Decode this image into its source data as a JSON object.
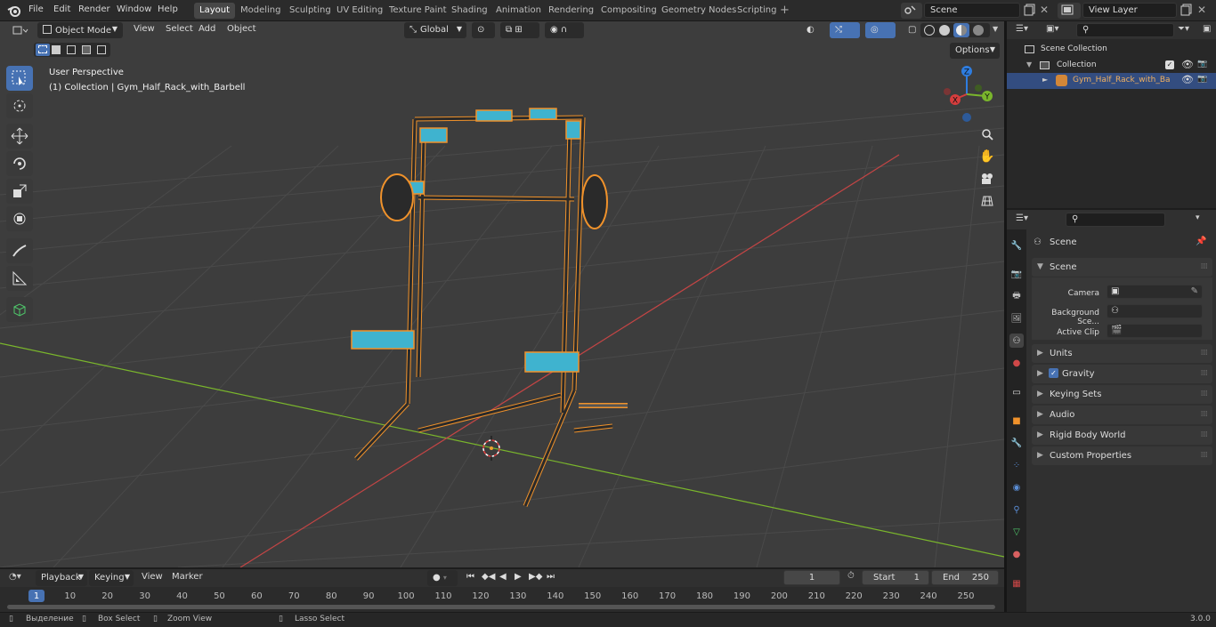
{
  "topbar": {
    "menus": [
      "File",
      "Edit",
      "Render",
      "Window",
      "Help"
    ],
    "workspaces": [
      "Layout",
      "Modeling",
      "Sculpting",
      "UV Editing",
      "Texture Paint",
      "Shading",
      "Animation",
      "Rendering",
      "Compositing",
      "Geometry Nodes",
      "Scripting"
    ],
    "active_workspace": "Layout",
    "add_tab": "+",
    "scene_value": "Scene",
    "view_layer_value": "View Layer"
  },
  "viewport": {
    "mode": "Object Mode",
    "menus": [
      "View",
      "Select",
      "Add",
      "Object"
    ],
    "orientation": "Global",
    "options_label": "Options",
    "overlay_title": "User Perspective",
    "overlay_subtitle": "(1) Collection | Gym_Half_Rack_with_Barbell",
    "gizmo": {
      "x": "X",
      "y": "Y",
      "z": "Z"
    }
  },
  "outliner": {
    "scene_collection": "Scene Collection",
    "collection": "Collection",
    "object": "Gym_Half_Rack_with_Ba"
  },
  "properties": {
    "header": "Scene",
    "section": "Scene",
    "camera_label": "Camera",
    "background_label": "Background Sce...",
    "clip_label": "Active Clip",
    "panels": [
      "Units",
      "Gravity",
      "Keying Sets",
      "Audio",
      "Rigid Body World",
      "Custom Properties"
    ],
    "gravity_checked": true
  },
  "timeline": {
    "menus": [
      "Playback",
      "Keying",
      "View",
      "Marker"
    ],
    "current_frame": "1",
    "start_label": "Start",
    "start_value": "1",
    "end_label": "End",
    "end_value": "250",
    "ticks": [
      "1",
      "10",
      "20",
      "30",
      "40",
      "50",
      "60",
      "70",
      "80",
      "90",
      "100",
      "110",
      "120",
      "130",
      "140",
      "150",
      "160",
      "170",
      "180",
      "190",
      "200",
      "210",
      "220",
      "230",
      "240",
      "250"
    ]
  },
  "statusbar": {
    "select": "Выделение",
    "box_select": "Box Select",
    "zoom_view": "Zoom View",
    "lasso_select": "Lasso Select",
    "version": "3.0.0"
  },
  "colors": {
    "accent": "#4772b3",
    "selection_outline": "#f0922b",
    "rack_accent": "#3fb3cf",
    "x_axis": "#d63d3d",
    "y_axis": "#7ab62c",
    "z_axis": "#2e7de0"
  }
}
